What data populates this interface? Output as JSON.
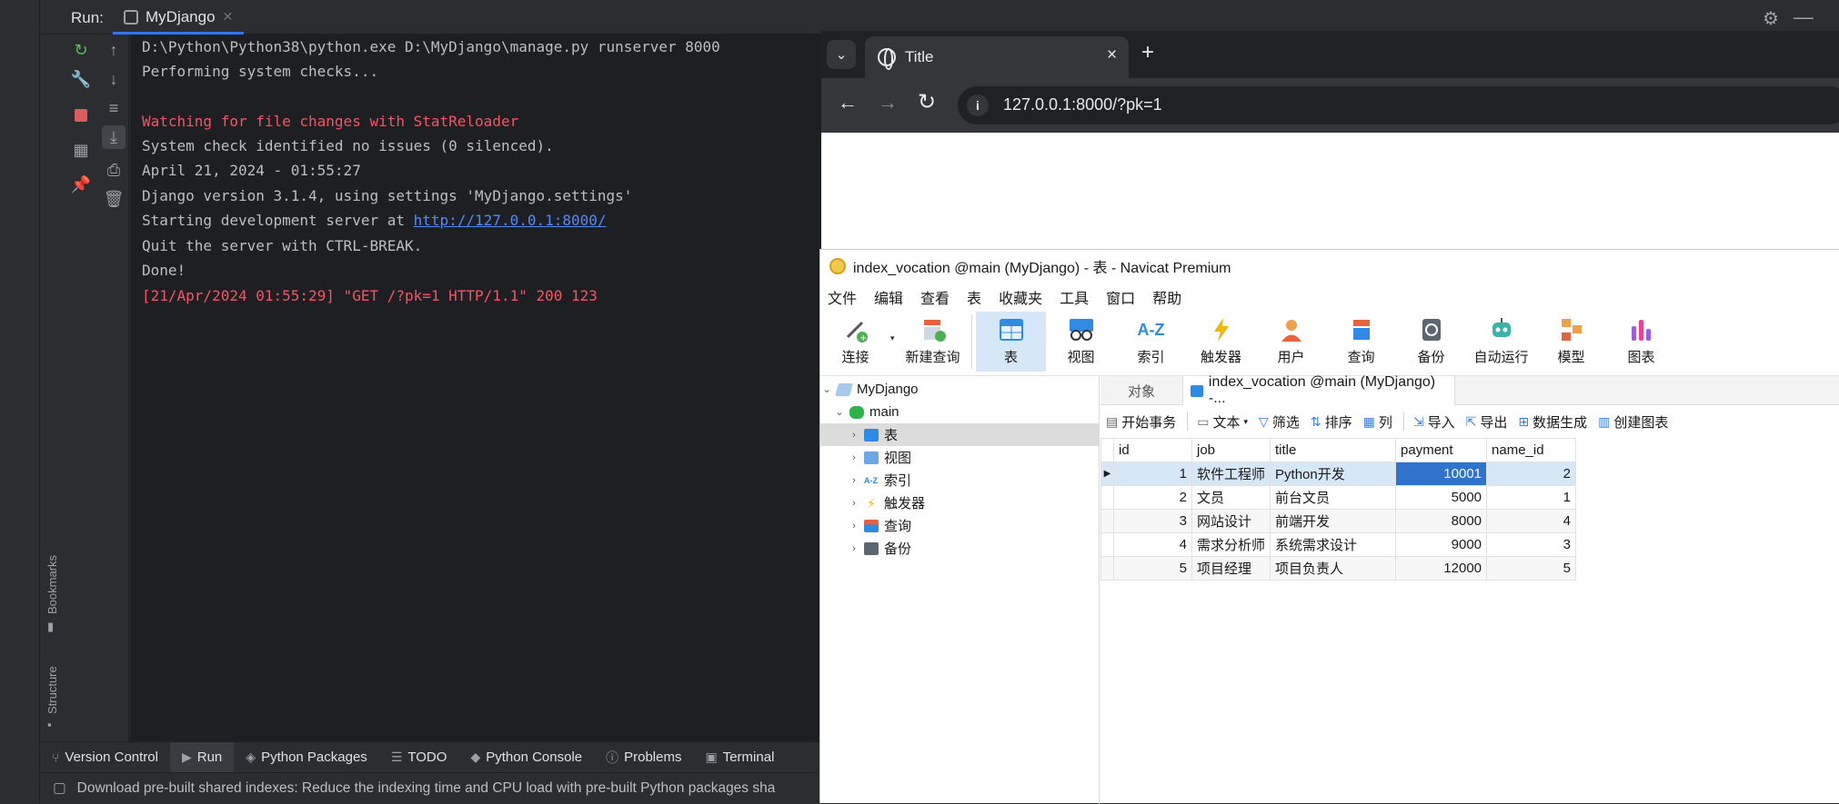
{
  "ide": {
    "run_label": "Run:",
    "run_tab": "MyDjango",
    "console_lines": [
      {
        "text": "D:\\Python\\Python38\\python.exe D:\\MyDjango\\manage.py runserver 8000",
        "kind": "normal"
      },
      {
        "text": "Performing system checks...",
        "kind": "normal"
      },
      {
        "text": "",
        "kind": "normal"
      },
      {
        "text": "Watching for file changes with StatReloader",
        "kind": "red"
      },
      {
        "text": "System check identified no issues (0 silenced).",
        "kind": "normal"
      },
      {
        "text": "April 21, 2024 - 01:55:27",
        "kind": "normal"
      },
      {
        "text": "Django version 3.1.4, using settings 'MyDjango.settings'",
        "kind": "normal"
      },
      {
        "text": "Starting development server at ",
        "kind": "normal",
        "link": "http://127.0.0.1:8000/"
      },
      {
        "text": "Quit the server with CTRL-BREAK.",
        "kind": "normal"
      },
      {
        "text": "Done!",
        "kind": "normal"
      },
      {
        "text": "[21/Apr/2024 01:55:29] \"GET /?pk=1 HTTP/1.1\" 200 123",
        "kind": "red"
      }
    ],
    "side_labels": {
      "bookmarks": "Bookmarks",
      "structure": "Structure"
    },
    "bottom_tabs": [
      "Version Control",
      "Run",
      "Python Packages",
      "TODO",
      "Python Console",
      "Problems",
      "Terminal"
    ],
    "active_bottom_tab": "Run",
    "status_text": "Download pre-built shared indexes: Reduce the indexing time and CPU load with pre-built Python packages sha"
  },
  "browser": {
    "tab_title": "Title",
    "url": "127.0.0.1:8000/?pk=1",
    "tab_close": "×",
    "new_tab": "+"
  },
  "navicat": {
    "window_title": "index_vocation @main (MyDjango) - 表 - Navicat Premium",
    "menu": [
      "文件",
      "编辑",
      "查看",
      "表",
      "收藏夹",
      "工具",
      "窗口",
      "帮助"
    ],
    "toolbar": [
      {
        "label": "连接",
        "icon": "connect-icon"
      },
      {
        "label": "新建查询",
        "icon": "new-query-icon"
      },
      {
        "label": "表",
        "icon": "table-icon",
        "active": true
      },
      {
        "label": "视图",
        "icon": "view-icon"
      },
      {
        "label": "索引",
        "icon": "index-icon"
      },
      {
        "label": "触发器",
        "icon": "trigger-icon"
      },
      {
        "label": "用户",
        "icon": "user-icon"
      },
      {
        "label": "查询",
        "icon": "query-icon"
      },
      {
        "label": "备份",
        "icon": "backup-icon"
      },
      {
        "label": "自动运行",
        "icon": "automation-icon"
      },
      {
        "label": "模型",
        "icon": "model-icon"
      },
      {
        "label": "图表",
        "icon": "chart-icon"
      }
    ],
    "tree": {
      "connection": "MyDjango",
      "database": "main",
      "items": [
        "表",
        "视图",
        "索引",
        "触发器",
        "查询",
        "备份"
      ]
    },
    "content_tabs": {
      "objects": "对象",
      "table_tab": "index_vocation @main (MyDjango) -..."
    },
    "grid_toolbar": [
      "开始事务",
      "文本",
      "筛选",
      "排序",
      "列",
      "导入",
      "导出",
      "数据生成",
      "创建图表"
    ],
    "table": {
      "columns": [
        "id",
        "job",
        "title",
        "payment",
        "name_id"
      ],
      "rows": [
        [
          "1",
          "软件工程师",
          "Python开发",
          "10001",
          "2"
        ],
        [
          "2",
          "文员",
          "前台文员",
          "5000",
          "1"
        ],
        [
          "3",
          "网站设计",
          "前端开发",
          "8000",
          "4"
        ],
        [
          "4",
          "需求分析师",
          "系统需求设计",
          "9000",
          "3"
        ],
        [
          "5",
          "项目经理",
          "项目负责人",
          "12000",
          "5"
        ]
      ]
    }
  }
}
